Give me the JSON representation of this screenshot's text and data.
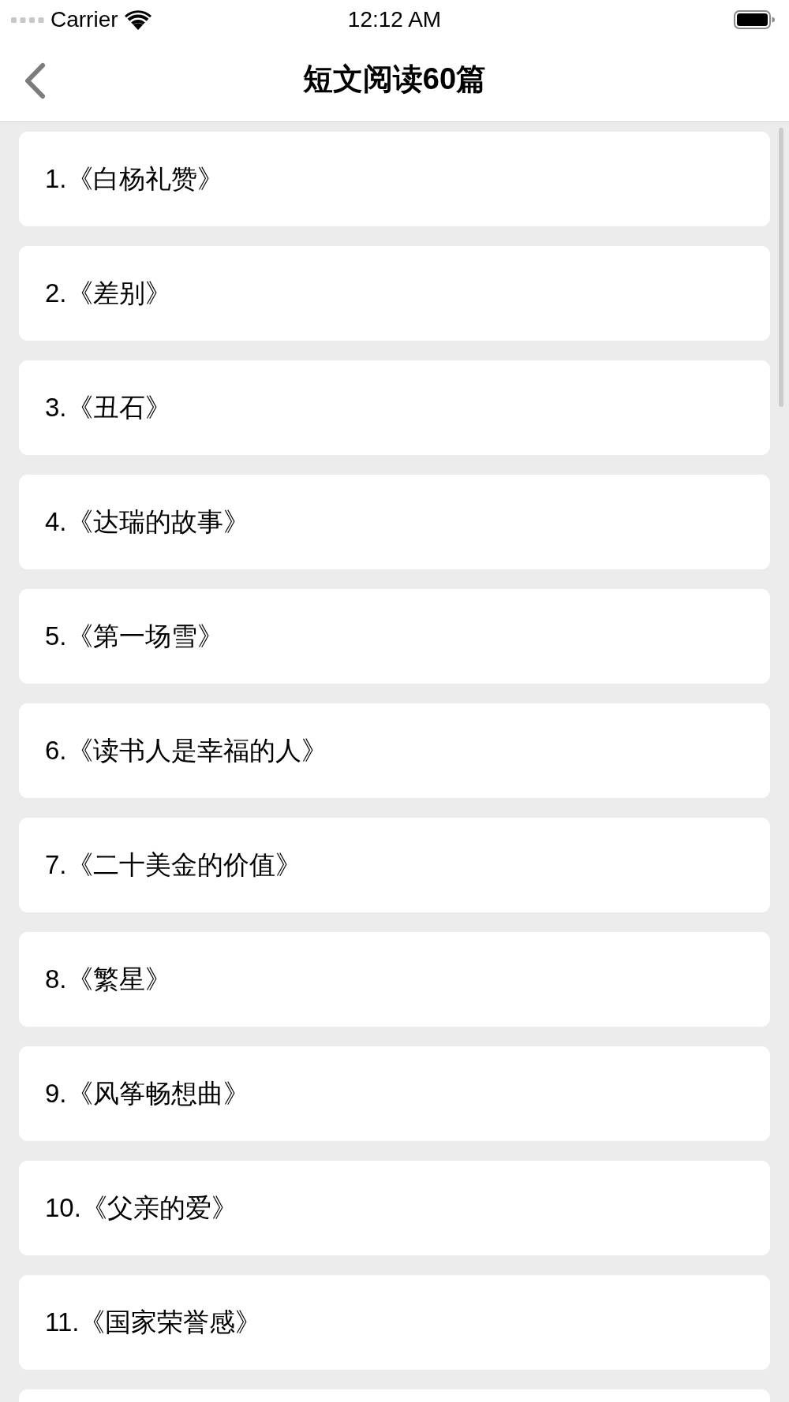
{
  "status_bar": {
    "carrier": "Carrier",
    "time": "12:12 AM"
  },
  "nav_bar": {
    "title": "短文阅读60篇"
  },
  "list": {
    "items": [
      "1.《白杨礼赞》",
      "2.《差别》",
      "3.《丑石》",
      "4.《达瑞的故事》",
      "5.《第一场雪》",
      "6.《读书人是幸福的人》",
      "7.《二十美金的价值》",
      "8.《繁星》",
      "9.《风筝畅想曲》",
      "10.《父亲的爱》",
      "11.《国家荣誉感》"
    ],
    "next_item_peeking": true
  }
}
